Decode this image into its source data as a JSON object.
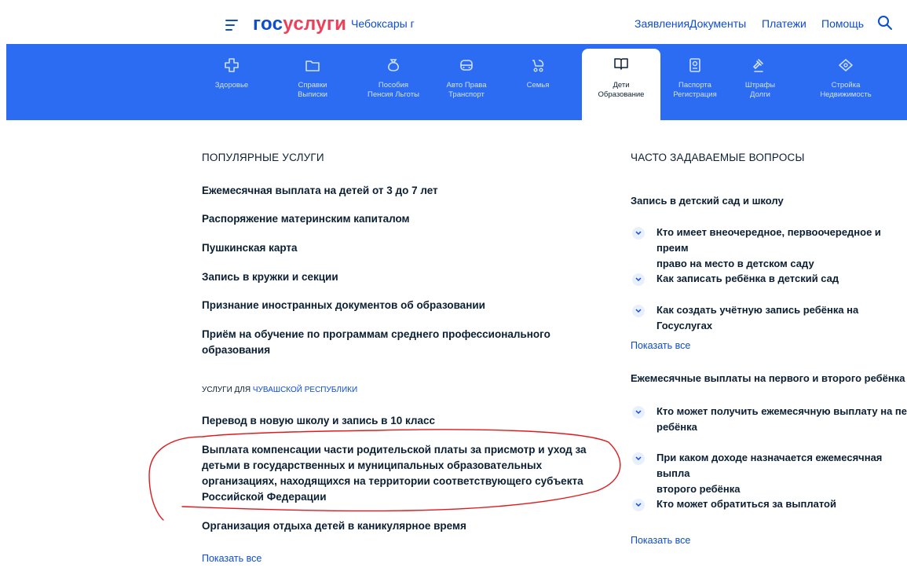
{
  "header": {
    "logo_part1": "гос",
    "logo_part2": "услуги",
    "city": "Чебоксары г",
    "nav": [
      "Заявления",
      "Документы",
      "Платежи",
      "Помощь"
    ]
  },
  "categories": [
    {
      "label": "Здоровье",
      "icon": "cross-icon"
    },
    {
      "label": "Справки\nВыписки",
      "icon": "folder-icon"
    },
    {
      "label": "Пособия\nПенсия Льготы",
      "icon": "money-bag-icon"
    },
    {
      "label": "Авто Права\nТранспорт",
      "icon": "car-icon"
    },
    {
      "label": "Семья",
      "icon": "stroller-icon"
    },
    {
      "label": "Дети\nОбразование",
      "icon": "book-icon"
    },
    {
      "label": "Паспорта\nРегистрация",
      "icon": "passport-icon"
    },
    {
      "label": "Штрафы\nДолги",
      "icon": "gavel-icon"
    },
    {
      "label": "Стройка\nНедвижимость",
      "icon": "house-icon"
    }
  ],
  "popular": {
    "title": "ПОПУЛЯРНЫЕ УСЛУГИ",
    "items": [
      "Ежемесячная выплата на детей от 3 до 7 лет",
      "Распоряжение материнским капиталом",
      "Пушкинская карта",
      "Запись в кружки и секции",
      "Признание иностранных документов об образовании",
      "Приём на обучение по программам среднего профессионального образования"
    ],
    "region_prefix": "УСЛУГИ ДЛЯ ",
    "region_name": "ЧУВАШСКОЙ РЕСПУБЛИКИ",
    "region_items": [
      "Перевод в новую школу и запись в 10 класс",
      "Выплата компенсации части родительской платы за присмотр и уход за детьми в государственных и муниципальных образовательных организациях, находящихся на территории соответствующего субъекта Российской Федерации",
      "Организация отдыха детей в каникулярное время"
    ],
    "show_all": "Показать все"
  },
  "faq": {
    "title": "ЧАСТО ЗАДАВАЕМЫЕ ВОПРОСЫ",
    "group1": {
      "title": "Запись в детский сад и школу",
      "questions": [
        "Кто имеет внеочередное, первоочередное и преим\nправо на место в детском саду",
        "Как записать ребёнка в детский сад",
        "Как создать учётную запись ребёнка на Госуслугах"
      ],
      "show_all": "Показать все"
    },
    "group2": {
      "title": "Ежемесячные выплаты на первого и второго ребёнка до",
      "questions": [
        "Кто может получить ежемесячную выплату на пер\nребёнка",
        "При каком доходе назначается ежемесячная выпла\nвторого ребёнка",
        "Кто может обратиться за выплатой"
      ],
      "show_all": "Показать все"
    }
  },
  "colors": {
    "brand_blue": "#0d4cd3",
    "band_blue": "#2c6cf3",
    "logo_red": "#ee3f58",
    "annotation_red": "#e0191c"
  }
}
